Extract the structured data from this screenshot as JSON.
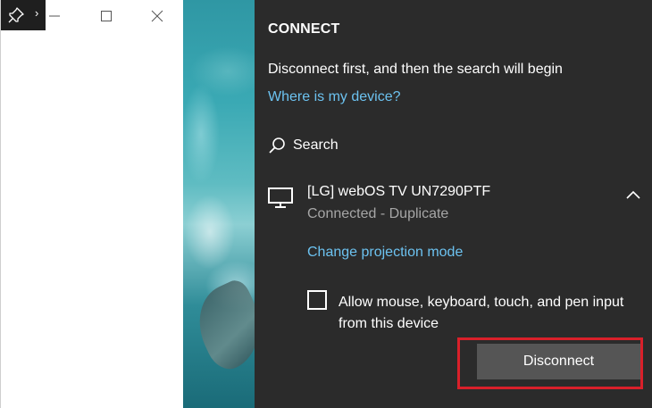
{
  "window": {
    "pin_icon": "pin-icon",
    "chevron": "›",
    "minimize_icon": "minimize-icon",
    "maximize_icon": "maximize-icon",
    "close_icon": "close-icon"
  },
  "panel": {
    "title": "CONNECT",
    "message": "Disconnect first, and then the search will begin",
    "where_link": "Where is my device?",
    "search_label": "Search",
    "device": {
      "name": "[LG] webOS TV UN7290PTF",
      "status": "Connected - Duplicate",
      "icon": "monitor-icon"
    },
    "projection_link": "Change projection mode",
    "allow_input_label": "Allow mouse, keyboard, touch, and pen input from this device",
    "allow_input_checked": false,
    "disconnect_label": "Disconnect"
  },
  "colors": {
    "panel_bg": "#2b2b2b",
    "link": "#6cc2f0",
    "secondary_text": "#a6a6a6",
    "button_bg": "#555555",
    "highlight": "#d9202a"
  }
}
